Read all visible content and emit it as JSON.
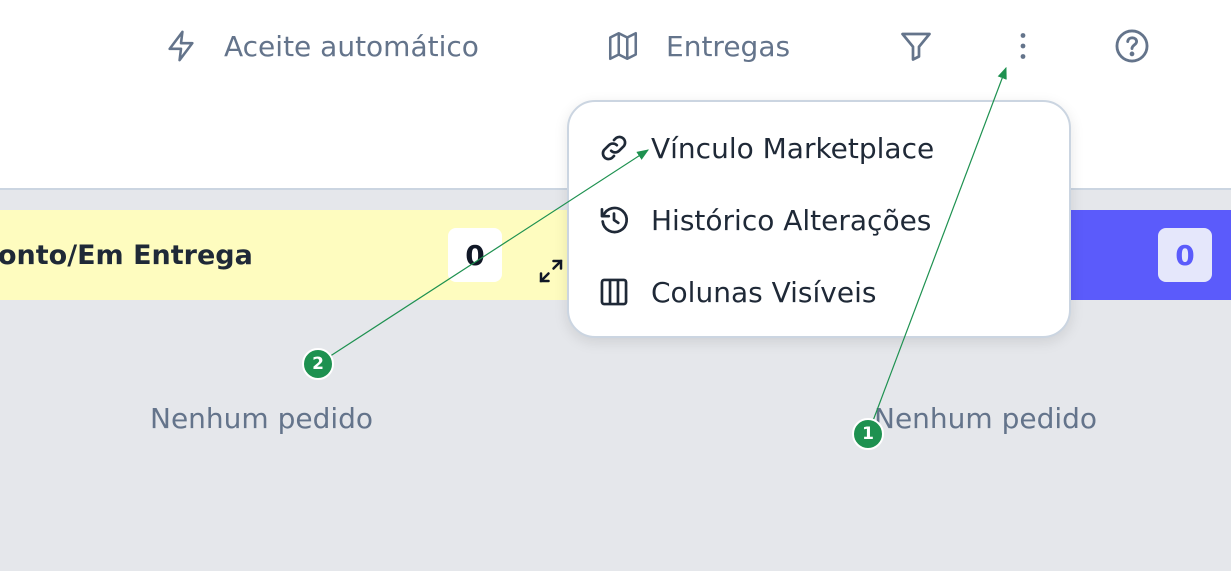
{
  "toolbar": {
    "auto_accept_label": "Aceite automático",
    "deliveries_label": "Entregas",
    "icons": [
      "lightning-icon",
      "map-icon",
      "filter-icon",
      "more-vertical-icon",
      "help-icon"
    ]
  },
  "menu": {
    "items": [
      {
        "label": "Vínculo Marketplace",
        "icon": "link-icon"
      },
      {
        "label": "Histórico Alterações",
        "icon": "history-icon"
      },
      {
        "label": "Colunas Visíveis",
        "icon": "columns-icon"
      }
    ]
  },
  "board": {
    "columns": [
      {
        "title": "onto/Em Entrega",
        "count": "0",
        "color": "#fefcbf",
        "empty": "Nenhum pedido"
      },
      {
        "title": "",
        "count": "0",
        "color": "#5b5bfb",
        "empty": "Nenhum pedido"
      }
    ]
  },
  "annotations": {
    "markers": [
      "1",
      "2"
    ],
    "color": "#1e9150"
  }
}
